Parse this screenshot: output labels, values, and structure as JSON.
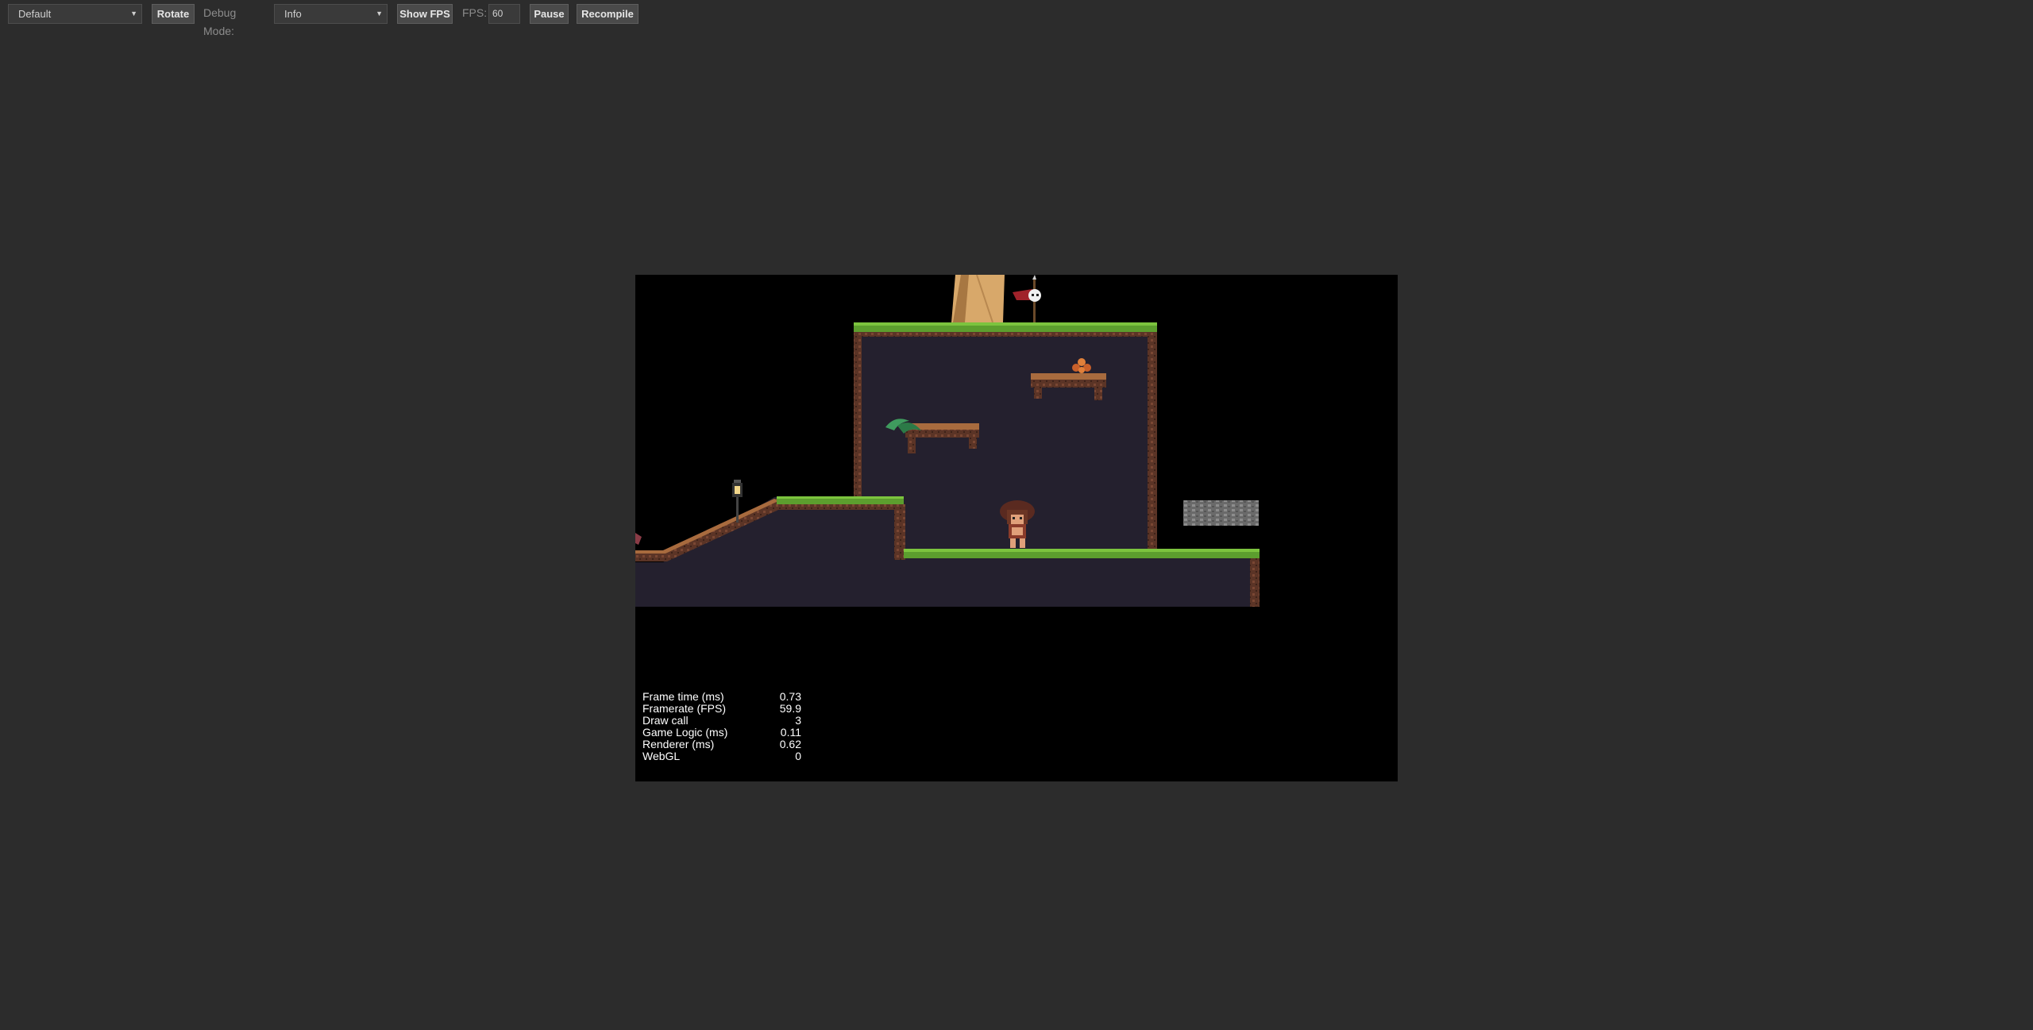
{
  "toolbar": {
    "profile_select": "Default",
    "rotate_label": "Rotate",
    "debug_mode_label": "Debug Mode:",
    "debug_mode_select": "Info",
    "show_fps_label": "Show FPS",
    "fps_label": "FPS:",
    "fps_value": "60",
    "pause_label": "Pause",
    "recompile_label": "Recompile"
  },
  "stats": [
    {
      "label": "Frame time (ms)",
      "value": "0.73"
    },
    {
      "label": "Framerate (FPS)",
      "value": "59.9"
    },
    {
      "label": "Draw call",
      "value": "3"
    },
    {
      "label": "Game Logic (ms)",
      "value": "0.11"
    },
    {
      "label": "Renderer (ms)",
      "value": "0.62"
    },
    {
      "label": "WebGL",
      "value": "0"
    }
  ],
  "colors": {
    "page_bg": "#2c2c2c",
    "canvas_bg": "#000000",
    "cave_bg": "#24202e",
    "grass": "#5c9e2e",
    "dirt": "#6a3b2a",
    "stone": "#7a7a7a"
  }
}
